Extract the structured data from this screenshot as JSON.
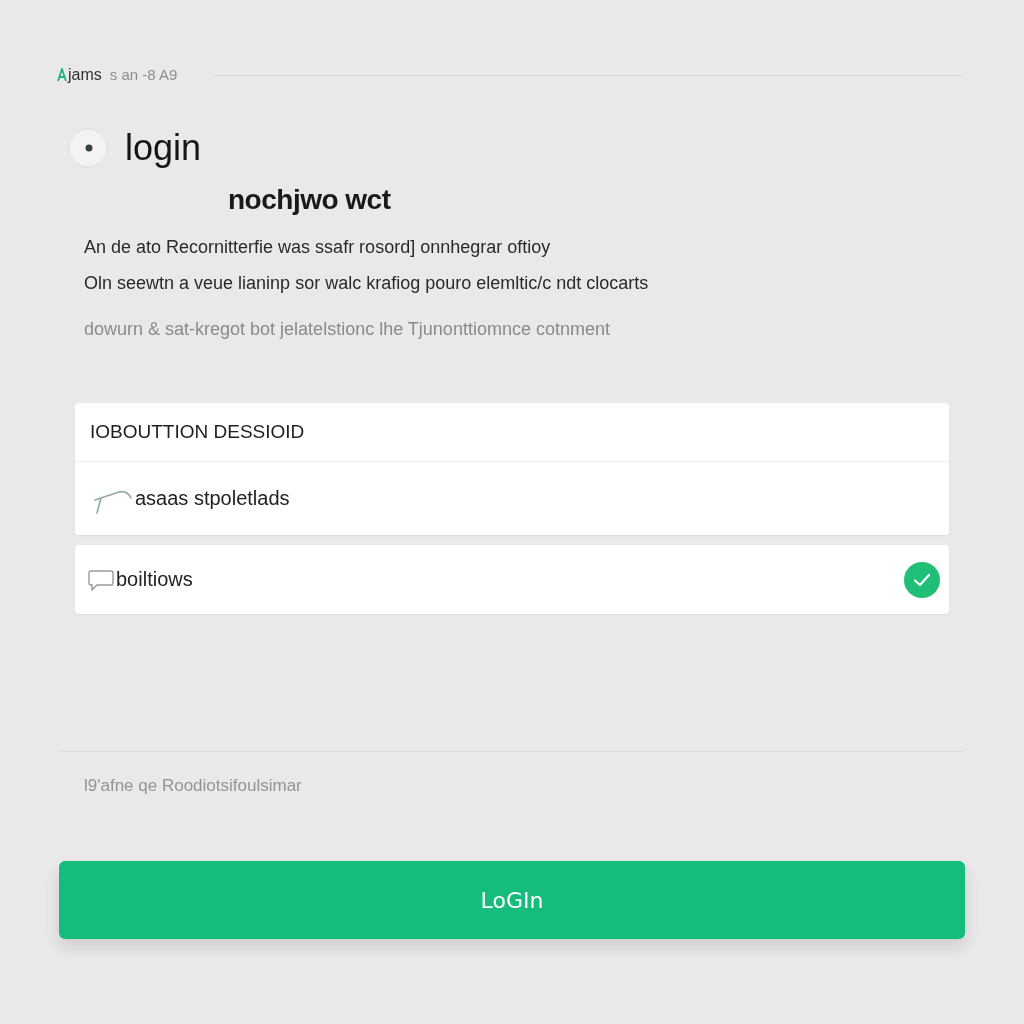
{
  "header": {
    "brand": "jams",
    "meta": "s an -8 A9"
  },
  "title": "login",
  "subtitle": "nochjwo wct",
  "description": [
    {
      "text": "An de ato Recornitterfie was ssafr rosord] onnhegrar oftioy",
      "muted": false
    },
    {
      "text": "Oln seewtn a veue lianinp sor walc krafiog pouro elemltic/c ndt clocarts",
      "muted": false
    },
    {
      "text": "dowurn & sat-kregot bot jelatelstionc lhe Tjunonttiomnce cotnment",
      "muted": true
    }
  ],
  "form": {
    "heading": "IOBOUTTION DESSIOID",
    "fields": [
      {
        "value": "asaas stpoletlads",
        "checked": false
      },
      {
        "value": "boiltiows",
        "checked": true
      }
    ]
  },
  "footnote": "l9'afne qe Roodiotsifoulsimar",
  "button": {
    "label": "LoGIn"
  }
}
